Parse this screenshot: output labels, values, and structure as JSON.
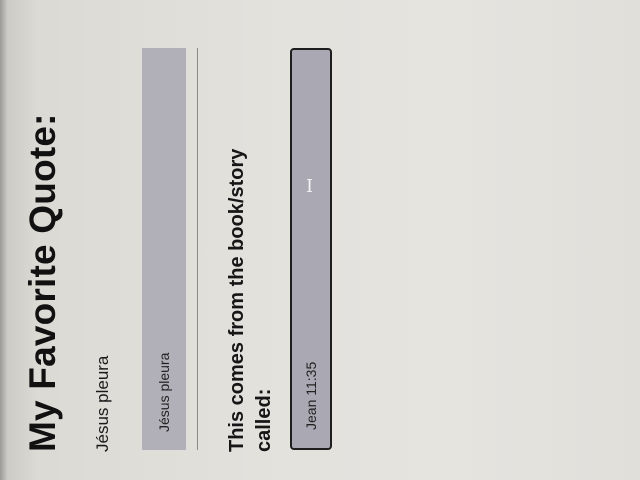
{
  "title": "My Favorite Quote:",
  "quote": {
    "text": "Jésus pleura",
    "field_value": "Jésus pleura"
  },
  "source": {
    "heading": "This comes from the book/story called:",
    "field_value": "Jean 11:35"
  },
  "cursor_icon": "I"
}
